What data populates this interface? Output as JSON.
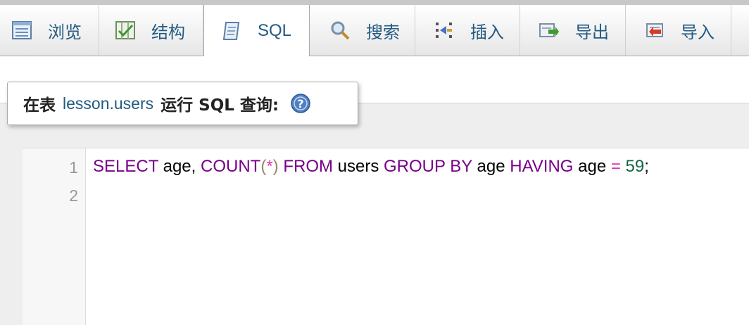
{
  "tabs": [
    {
      "label": "浏览",
      "icon": "browse-icon",
      "active": false
    },
    {
      "label": "结构",
      "icon": "structure-icon",
      "active": false
    },
    {
      "label": "SQL",
      "icon": "sql-icon",
      "active": true
    },
    {
      "label": "搜索",
      "icon": "search-icon",
      "active": false
    },
    {
      "label": "插入",
      "icon": "insert-icon",
      "active": false
    },
    {
      "label": "导出",
      "icon": "export-icon",
      "active": false
    },
    {
      "label": "导入",
      "icon": "import-icon",
      "active": false
    }
  ],
  "query_panel": {
    "prefix": "在表",
    "table_name": "lesson.users",
    "suffix": "运行 SQL 查询:",
    "help_icon": "help-icon"
  },
  "editor": {
    "line_numbers": [
      "1",
      "2"
    ],
    "tokens": {
      "select": "SELECT",
      "age1": " age, ",
      "count": "COUNT",
      "lparen": "(",
      "star": "*",
      "rparen": ")",
      "from": " FROM",
      "users": " users ",
      "groupby": "GROUP BY",
      "age2": " age ",
      "having": "HAVING",
      "age3": " age ",
      "eq": "=",
      "sp": " ",
      "num": "59",
      "semi": ";"
    }
  },
  "colors": {
    "keyword": "#770088",
    "number": "#116644",
    "operator": "#dd33aa",
    "link": "#235a81"
  }
}
